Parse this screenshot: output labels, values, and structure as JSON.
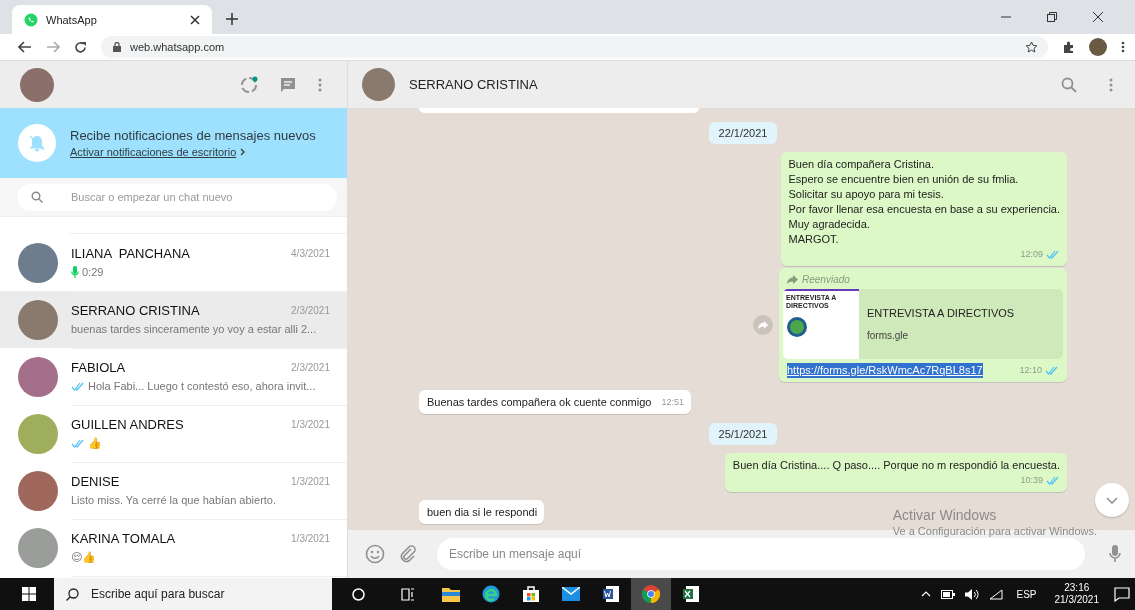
{
  "browser": {
    "tab_title": "WhatsApp",
    "url": "web.whatsapp.com"
  },
  "sidebar": {
    "notification": {
      "title": "Recibe notificaciones de mensajes nuevos",
      "link": "Activar notificaciones de escritorio"
    },
    "search": {
      "placeholder": "Buscar o empezar un chat nuevo"
    },
    "chats": [
      {
        "name": "ILIANA  PANCHANA",
        "date": "4/3/2021",
        "preview": "0:29",
        "kind": "voice",
        "selected": false
      },
      {
        "name": "SERRANO CRISTINA",
        "date": "2/3/2021",
        "preview": "buenas tardes sinceramente yo voy a estar alli 2...",
        "kind": "text",
        "selected": true
      },
      {
        "name": "FABIOLA",
        "date": "2/3/2021",
        "preview": "Hola Fabi... Luego t contestó eso, ahora invit...",
        "kind": "read",
        "selected": false
      },
      {
        "name": "GUILLEN ANDRES",
        "date": "1/3/2021",
        "preview": "👍",
        "kind": "read",
        "selected": false
      },
      {
        "name": "DENISE",
        "date": "1/3/2021",
        "preview": "Listo miss. Ya cerré la que habían abierto.",
        "kind": "text",
        "selected": false
      },
      {
        "name": "KARINA TOMALA",
        "date": "1/3/2021",
        "preview": "😌👍",
        "kind": "text",
        "selected": false
      }
    ]
  },
  "chat": {
    "contact": "SERRANO CRISTINA",
    "messages": [
      {
        "kind": "date",
        "text": "22/1/2021"
      },
      {
        "kind": "out",
        "lines": [
          "Buen día compañera Cristina.",
          "Espero se encuentre bien en unión de su fmlia.",
          "Solicitar su apoyo para mi tesis.",
          "Por favor llenar esa encuesta en base a su experiencia.",
          "Muy agradecida.",
          "MARGOT."
        ],
        "time": "12:09",
        "read": true
      },
      {
        "kind": "link",
        "forwarded": "Reenviado",
        "thumb_title": "ENTREVISTA A DIRECTIVOS",
        "title": "ENTREVISTA A DIRECTIVOS",
        "domain": "forms.gle",
        "url": "https://forms.gle/RskWmcAc7RqBL8s17",
        "time": "12:10",
        "read": true
      },
      {
        "kind": "in",
        "lines": [
          "Buenas tardes compañera ok cuente conmigo"
        ],
        "time": "12:51"
      },
      {
        "kind": "date",
        "text": "25/1/2021"
      },
      {
        "kind": "out",
        "lines": [
          "Buen día Cristina.... Q paso.... Porque no m respondió la encuesta."
        ],
        "time": "10:39",
        "read": true
      },
      {
        "kind": "in",
        "lines": [
          "buen dia si le respondi"
        ]
      }
    ],
    "composer": {
      "placeholder": "Escribe un mensaje aquí"
    }
  },
  "os_notice": {
    "title": "Activar Windows",
    "text": "Ve a Configuración para activar Windows."
  },
  "taskbar": {
    "search": "Escribe aquí para buscar",
    "time": "23:16",
    "date": "21/3/2021",
    "language": "ESP"
  }
}
